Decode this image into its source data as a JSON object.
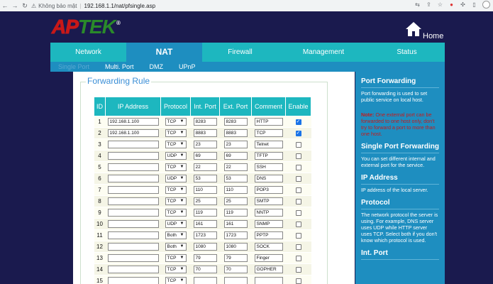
{
  "browser": {
    "insecure_label": "Không bảo mật",
    "url": "192.168.1.1/nat/pfsingle.asp"
  },
  "header": {
    "logo_ap": "AP",
    "logo_tek": "TEK",
    "logo_reg": "®",
    "home_label": "Home"
  },
  "main_nav": [
    {
      "label": "Network"
    },
    {
      "label": "NAT"
    },
    {
      "label": "Firewall"
    },
    {
      "label": "Management"
    },
    {
      "label": "Status"
    }
  ],
  "sub_nav": [
    {
      "label": "Single Port"
    },
    {
      "label": "Multi. Port"
    },
    {
      "label": "DMZ"
    },
    {
      "label": "UPnP"
    }
  ],
  "forwarding": {
    "legend": "Forwarding Rule",
    "columns": [
      "ID",
      "IP Address",
      "Protocol",
      "Int. Port",
      "Ext. Port",
      "Comment",
      "Enable"
    ],
    "rows": [
      {
        "id": "1",
        "ip": "192.168.1.100",
        "protocol": "TCP",
        "int": "8283",
        "ext": "8283",
        "comment": "HTTP",
        "enabled": true
      },
      {
        "id": "2",
        "ip": "192.168.1.100",
        "protocol": "TCP",
        "int": "8883",
        "ext": "8883",
        "comment": "TCP",
        "enabled": true
      },
      {
        "id": "3",
        "ip": "",
        "protocol": "TCP",
        "int": "23",
        "ext": "23",
        "comment": "Telnet",
        "enabled": false
      },
      {
        "id": "4",
        "ip": "",
        "protocol": "UDP",
        "int": "69",
        "ext": "69",
        "comment": "TFTP",
        "enabled": false
      },
      {
        "id": "5",
        "ip": "",
        "protocol": "TCP",
        "int": "22",
        "ext": "22",
        "comment": "SSH",
        "enabled": false
      },
      {
        "id": "6",
        "ip": "",
        "protocol": "UDP",
        "int": "53",
        "ext": "53",
        "comment": "DNS",
        "enabled": false
      },
      {
        "id": "7",
        "ip": "",
        "protocol": "TCP",
        "int": "110",
        "ext": "110",
        "comment": "POP3",
        "enabled": false
      },
      {
        "id": "8",
        "ip": "",
        "protocol": "TCP",
        "int": "25",
        "ext": "25",
        "comment": "SMTP",
        "enabled": false
      },
      {
        "id": "9",
        "ip": "",
        "protocol": "TCP",
        "int": "119",
        "ext": "119",
        "comment": "NNTP",
        "enabled": false
      },
      {
        "id": "10",
        "ip": "",
        "protocol": "UDP",
        "int": "161",
        "ext": "161",
        "comment": "SNMP",
        "enabled": false
      },
      {
        "id": "11",
        "ip": "",
        "protocol": "Both",
        "int": "1723",
        "ext": "1723",
        "comment": "PPTP",
        "enabled": false
      },
      {
        "id": "12",
        "ip": "",
        "protocol": "Both",
        "int": "1080",
        "ext": "1080",
        "comment": "SOCK",
        "enabled": false
      },
      {
        "id": "13",
        "ip": "",
        "protocol": "TCP",
        "int": "79",
        "ext": "79",
        "comment": "Finger",
        "enabled": false
      },
      {
        "id": "14",
        "ip": "",
        "protocol": "TCP",
        "int": "70",
        "ext": "70",
        "comment": "GOPHER",
        "enabled": false
      },
      {
        "id": "15",
        "ip": "",
        "protocol": "TCP",
        "int": "",
        "ext": "",
        "comment": "",
        "enabled": false
      }
    ]
  },
  "help": {
    "pf_title": "Port Forwarding",
    "pf_text": "Port forwarding is used to set public service on local host.",
    "note_label": "Note:",
    "note_text": " One external port can be forwarded to one host only, don't try to forward a port to more than one host.",
    "spf_title": "Single Port Forwarding",
    "spf_text": "You can set different internal and external port for the service.",
    "ip_title": "IP Address",
    "ip_text": "IP address of the local server.",
    "proto_title": "Protocol",
    "proto_text": "The network protocol the server is using. For example, DNS server uses UDP while HTTP server uses TCP. Select both if you don't know which protocol is used.",
    "intport_title": "Int. Port"
  },
  "colors": {
    "nav_teal": "#1db7bf",
    "nav_active": "#1e8ec0",
    "page_bg": "#1a1a4e",
    "logo_red": "#c81818",
    "logo_green": "#2a8a2a",
    "note_red": "#c51a1a"
  }
}
